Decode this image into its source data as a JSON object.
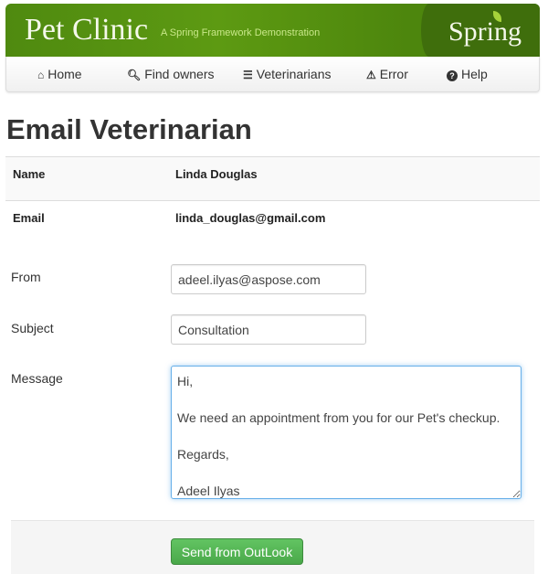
{
  "header": {
    "title": "Pet Clinic",
    "tagline": "A Spring Framework Demonstration",
    "logo": "Spring"
  },
  "nav": [
    {
      "label": "Home",
      "icon": "home-icon",
      "glyph": "⌂"
    },
    {
      "label": "Find owners",
      "icon": "search-icon",
      "glyph": "🔍︎"
    },
    {
      "label": "Veterinarians",
      "icon": "list-icon",
      "glyph": "☰"
    },
    {
      "label": "Error",
      "icon": "warning-icon",
      "glyph": "⚠"
    },
    {
      "label": "Help",
      "icon": "question-circle-icon",
      "glyph": "?"
    }
  ],
  "page": {
    "title": "Email Veterinarian"
  },
  "details": {
    "name_label": "Name",
    "name_value": "Linda Douglas",
    "email_label": "Email",
    "email_value": "linda_douglas@gmail.com"
  },
  "form": {
    "from_label": "From",
    "from_value": "adeel.ilyas@aspose.com",
    "subject_label": "Subject",
    "subject_value": "Consultation",
    "message_label": "Message",
    "message_value": "Hi,\n\nWe need an appointment from you for our Pet's checkup.\n\nRegards,\n\nAdeel Ilyas",
    "submit_label": "Send from OutLook"
  },
  "colors": {
    "banner": "#5d9a12",
    "button": "#5cb85c"
  }
}
